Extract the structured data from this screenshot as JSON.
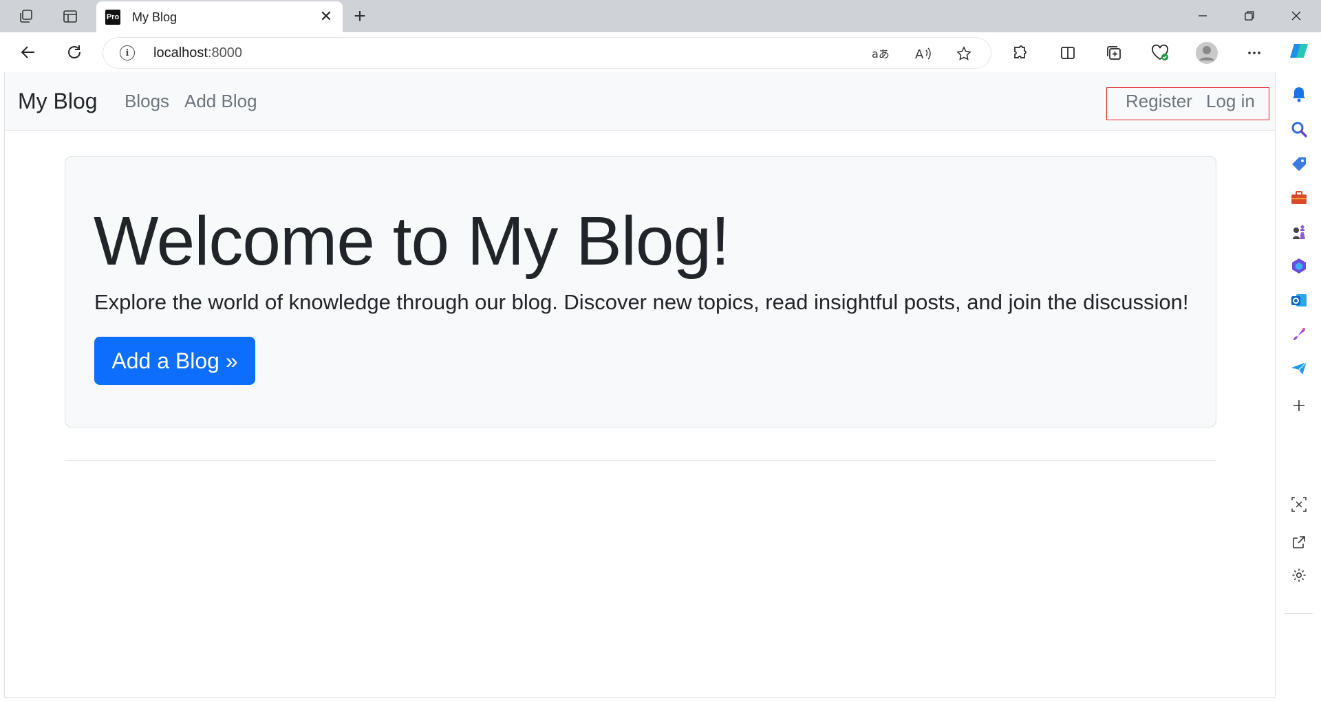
{
  "browser": {
    "tab_title": "My Blog",
    "tab_favicon_text": "Pro",
    "url_host": "localhost",
    "url_port": ":8000"
  },
  "site": {
    "brand": "My Blog",
    "nav_links": [
      "Blogs",
      "Add Blog"
    ],
    "auth_links": [
      "Register",
      "Log in"
    ]
  },
  "hero": {
    "title": "Welcome to My Blog!",
    "lead": "Explore the world of knowledge through our blog. Discover new topics, read insightful posts, and join the discussion!",
    "button": "Add a Blog »"
  },
  "colors": {
    "primary": "#0d6efd",
    "highlight_box": "#e02424",
    "navbar_bg": "#f8f9fa"
  }
}
